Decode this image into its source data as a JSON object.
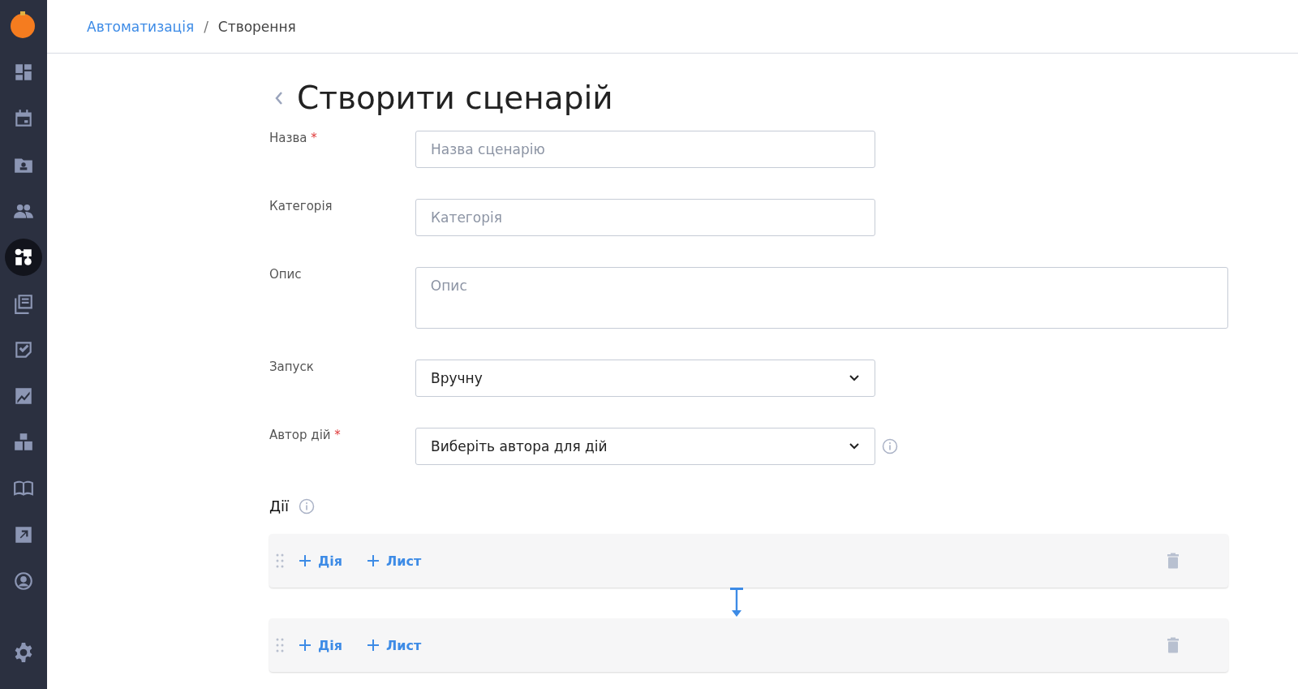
{
  "sidebar": {
    "items": [
      {
        "selected": false
      },
      {
        "selected": false
      },
      {
        "selected": false
      },
      {
        "selected": false
      },
      {
        "selected": true
      },
      {
        "selected": false
      },
      {
        "selected": false
      },
      {
        "selected": false
      },
      {
        "selected": false
      },
      {
        "selected": false
      },
      {
        "selected": false
      },
      {
        "selected": false
      }
    ]
  },
  "breadcrumb": [
    {
      "label": "Автоматизація",
      "kind": "link"
    },
    {
      "label": "Створення",
      "kind": "current"
    }
  ],
  "breadcrumb_separator": "/",
  "page_title": "Створити сценарій",
  "fields": [
    {
      "label": "Назва",
      "required": true,
      "kind": "input",
      "placeholder": "Назва сценарію"
    },
    {
      "label": "Категорія",
      "required": false,
      "kind": "input",
      "placeholder": "Категорія"
    },
    {
      "label": "Опис",
      "required": false,
      "kind": "textarea",
      "placeholder": "Опис"
    },
    {
      "label": "Запуск",
      "required": false,
      "kind": "select",
      "value": "Вручну"
    },
    {
      "label": "Автор дій",
      "required": true,
      "kind": "select",
      "value": "Виберіть автора для дій",
      "info": true
    }
  ],
  "required_mark": "*",
  "actions": {
    "title": "Дії",
    "blocks": [
      {
        "buttons": [
          "Дія",
          "Лист"
        ]
      },
      {
        "buttons": [
          "Дія",
          "Лист"
        ]
      }
    ]
  }
}
